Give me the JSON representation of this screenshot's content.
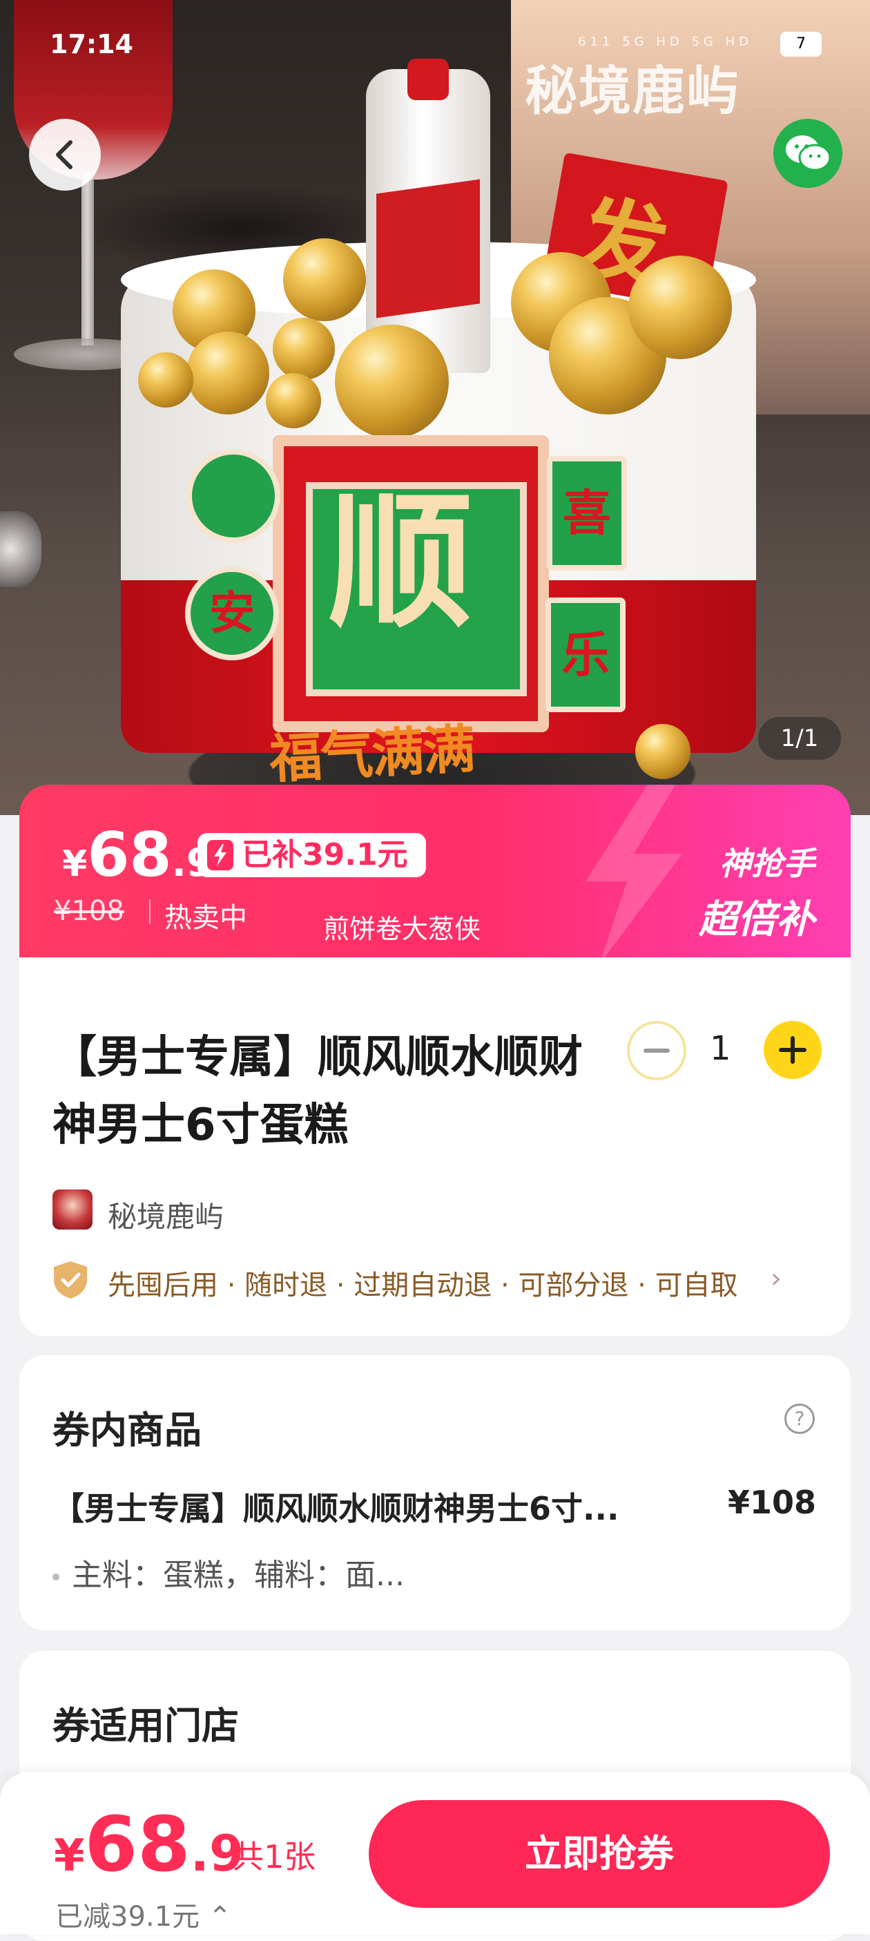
{
  "status_bar": {
    "time": "17:14",
    "icons_text": "611 5G HD 5G HD",
    "battery": "7"
  },
  "hero": {
    "watermark": "秘境鹿屿",
    "cake_sign_char": "顺",
    "side_marks": [
      "喜",
      "乐",
      "安"
    ],
    "corner_card_char": "发",
    "cake_script": "福气满满",
    "image_counter": "1/1"
  },
  "nav": {
    "back_icon": "chevron-left-icon",
    "share_icon": "wechat-icon"
  },
  "price_band": {
    "currency": "¥",
    "price_int": "68",
    "price_dec": ".9",
    "subsidy": "已补39.1元",
    "original_price": "¥108",
    "status": "热卖中",
    "shop_caption": "煎饼卷大葱侠",
    "tag_line1": "神抢手",
    "tag_line2": "超倍补",
    "colors": {
      "start": "#ff3a63",
      "end": "#ff3fb3"
    }
  },
  "product": {
    "title": "【男士专属】顺风顺水顺财神男士6寸蛋糕",
    "quantity": "1",
    "shop_name": "秘境鹿屿",
    "guarantees": "先囤后用 · 随时退 · 过期自动退 · 可部分退 · 可自取"
  },
  "voucher_items": {
    "section_title": "券内商品",
    "item_name": "【男士专属】顺风顺水顺财神男士6寸...",
    "item_price": "¥108",
    "item_desc": "主料：蛋糕，辅料：面..."
  },
  "stores": {
    "section_title": "券适用门店"
  },
  "bottom_bar": {
    "currency": "¥",
    "price_int": "68",
    "price_dec": ".9",
    "count": "共1张",
    "saved": "已减39.1元 ⌃",
    "cta": "立即抢券",
    "accent": "#ff2755"
  }
}
